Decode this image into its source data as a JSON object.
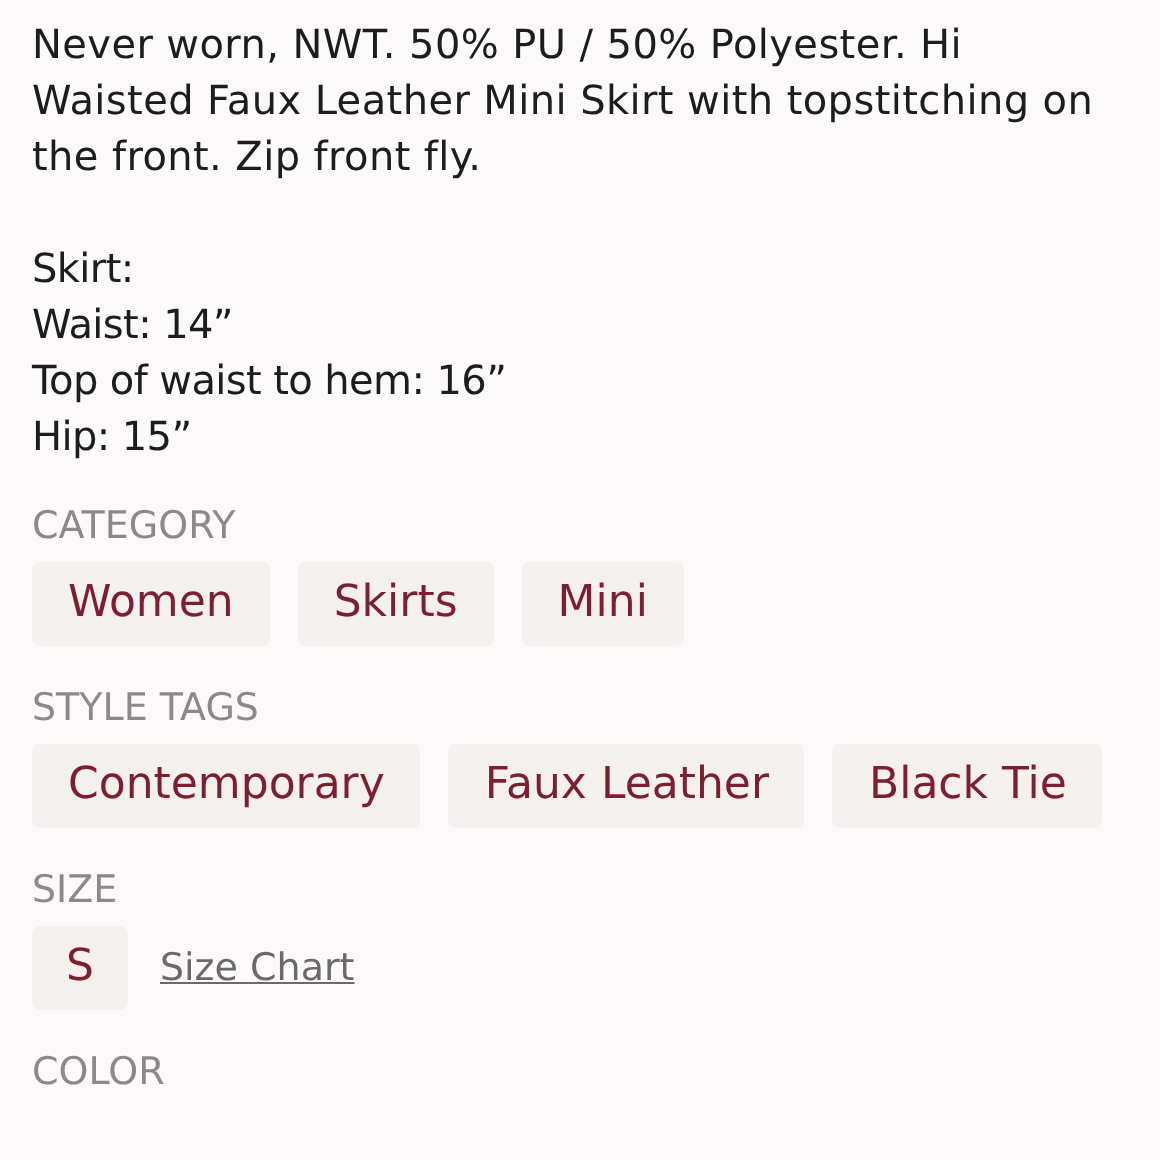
{
  "description": "Never worn, NWT. 50% PU / 50% Polyester. Hi Waisted Faux Leather Mini Skirt with topstitching on the front. Zip front fly.",
  "measurements": [
    "Skirt:",
    "Waist: 14”",
    "Top of waist to hem: 16”",
    "Hip: 15”"
  ],
  "sections": [
    {
      "kind": "tags",
      "heading": "CATEGORY",
      "items": [
        "Women",
        "Skirts",
        "Mini"
      ]
    },
    {
      "kind": "tags",
      "heading": "STYLE TAGS",
      "items": [
        "Contemporary",
        "Faux Leather",
        "Black Tie"
      ]
    },
    {
      "kind": "size",
      "heading": "SIZE",
      "items": [
        "S"
      ],
      "link": "Size Chart"
    },
    {
      "kind": "heading",
      "heading": "COLOR"
    }
  ]
}
